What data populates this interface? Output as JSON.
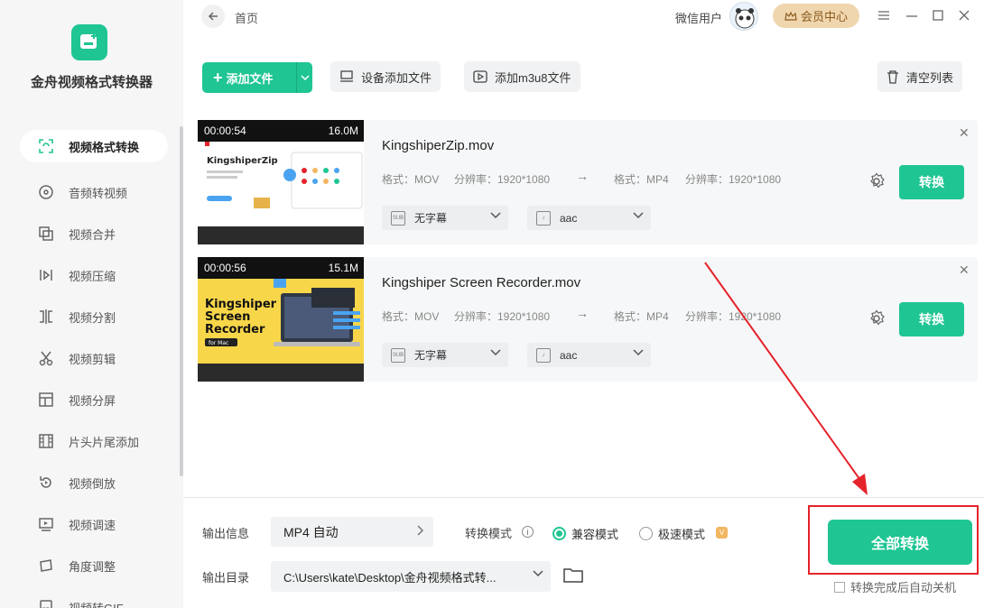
{
  "app": {
    "title": "金舟视频格式转换器"
  },
  "sidebar": {
    "items": [
      {
        "label": "视频格式转换",
        "icon": "convert-icon",
        "active": true
      },
      {
        "label": "音频转视频",
        "icon": "audio-disc-icon"
      },
      {
        "label": "视频合并",
        "icon": "merge-icon"
      },
      {
        "label": "视频压缩",
        "icon": "compress-icon"
      },
      {
        "label": "视频分割",
        "icon": "split-icon"
      },
      {
        "label": "视频剪辑",
        "icon": "scissors-icon"
      },
      {
        "label": "视频分屏",
        "icon": "split-screen-icon"
      },
      {
        "label": "片头片尾添加",
        "icon": "film-strip-icon"
      },
      {
        "label": "视频倒放",
        "icon": "rewind-icon"
      },
      {
        "label": "视频调速",
        "icon": "speed-icon"
      },
      {
        "label": "角度调整",
        "icon": "rotate-icon"
      },
      {
        "label": "视频转GIF",
        "icon": "gif-icon"
      }
    ]
  },
  "header": {
    "breadcrumb": "首页",
    "user": "微信用户",
    "vip_label": "会员中心"
  },
  "toolbar": {
    "add_file": "添加文件",
    "device_add": "设备添加文件",
    "add_m3u8": "添加m3u8文件",
    "clear_list": "清空列表"
  },
  "files": [
    {
      "duration": "00:00:54",
      "size": "16.0M",
      "thumb_title": "KingshiperZip",
      "name": "KingshiperZip.mov",
      "src_format": "格式：MOV",
      "src_res": "分辨率：1920*1080",
      "dst_format": "格式：MP4",
      "dst_res": "分辨率：1920*1080",
      "subtitle": "无字幕",
      "audio": "aac",
      "convert": "转换"
    },
    {
      "duration": "00:00:56",
      "size": "15.1M",
      "thumb_title": "Kingshiper Screen Recorder",
      "thumb_sub": "for Mac",
      "name": "Kingshiper Screen Recorder.mov",
      "src_format": "格式：MOV",
      "src_res": "分辨率：1920*1080",
      "dst_format": "格式：MP4",
      "dst_res": "分辨率：1920*1080",
      "subtitle": "无字幕",
      "audio": "aac",
      "convert": "转换"
    }
  ],
  "bottom": {
    "output_info_label": "输出信息",
    "output_info_value": "MP4 自动",
    "mode_label": "转换模式",
    "mode_compat": "兼容模式",
    "mode_fast": "极速模式",
    "output_dir_label": "输出目录",
    "output_dir_value": "C:\\Users\\kate\\Desktop\\金舟视频格式转...",
    "convert_all": "全部转换",
    "auto_shutdown": "转换完成后自动关机"
  },
  "colors": {
    "accent": "#1fc593",
    "annotation": "#e5232b",
    "vip": "#f0d6ae"
  }
}
